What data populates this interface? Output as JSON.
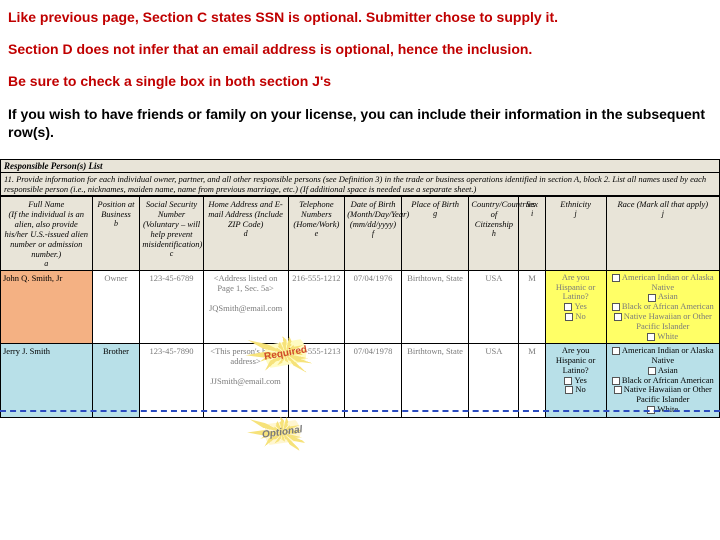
{
  "instructions": {
    "line1": "Like previous page, Section C states SSN is optional. Submitter chose to supply it.",
    "line2": "Section D does not infer that an email address is optional, hence the inclusion.",
    "line3": "Be sure to check a single box in both section J's",
    "line4": "If you wish to have friends or family on your license, you can include their information in the subsequent row(s)."
  },
  "section": {
    "title": "Responsible Person(s) List",
    "subhead": "11. Provide information for each individual owner, partner, and all other responsible persons (see Definition 3) in the trade or business operations identified in section A, block 2. List all names used by each responsible person (i.e., nicknames, maiden name, name from previous marriage, etc.) (If additional space is needed use a separate sheet.)"
  },
  "headers": {
    "fullname": "Full Name",
    "fullname_note": "(If the individual is an alien, also provide his/her U.S.-issued alien number or admission number.)",
    "fullname_letter": "a",
    "position": "Position at Business",
    "position_letter": "b",
    "ssn": "Social Security Number",
    "ssn_note": "(Voluntary – will help prevent misidentification)",
    "ssn_letter": "c",
    "address": "Home Address and E-mail Address (Include ZIP Code)",
    "address_letter": "d",
    "telephone": "Telephone Numbers (Home/Work)",
    "telephone_letter": "e",
    "dob": "Date of Birth (Month/Day/Year)",
    "dob_letter": "f",
    "dob_format": "(mm/dd/yyyy)",
    "pob": "Place of Birth",
    "pob_letter": "g",
    "citizenship": "Country/Countries of Citizenship",
    "citizenship_letter": "h",
    "sex": "Sex",
    "sex_letter": "i",
    "ethnicity": "Ethnicity",
    "ethnicity_letter": "j",
    "race": "Race (Mark all that apply)",
    "race_letter": "j"
  },
  "rows": [
    {
      "name": "John Q. Smith, Jr",
      "position": "Owner",
      "ssn": "123-45-6789",
      "address_line1": "<Address listed on Page 1, Sec. 5a>",
      "email": "JQSmith@email.com",
      "telephone": "216-555-1212",
      "dob": "07/04/1976",
      "pob": "Birthtown, State",
      "citizenship": "USA",
      "sex": "M"
    },
    {
      "name": "Jerry J. Smith",
      "position": "Brother",
      "ssn": "123-45-7890",
      "address_line1": "<This person's home address>",
      "email": "JJSmith@email.com",
      "telephone": "216-555-1213",
      "dob": "07/04/1978",
      "pob": "Birthtown, State",
      "citizenship": "USA",
      "sex": "M"
    }
  ],
  "ethnicity": {
    "question": "Are you Hispanic or Latino?",
    "yes": "Yes",
    "no": "No"
  },
  "race": {
    "opt1": "American Indian or Alaska Native",
    "opt2": "Asian",
    "opt3": "Black or African American",
    "opt4": "Native Hawaiian or Other Pacific Islander",
    "opt5": "White"
  },
  "callouts": {
    "required": "Required",
    "optional": "Optional"
  }
}
